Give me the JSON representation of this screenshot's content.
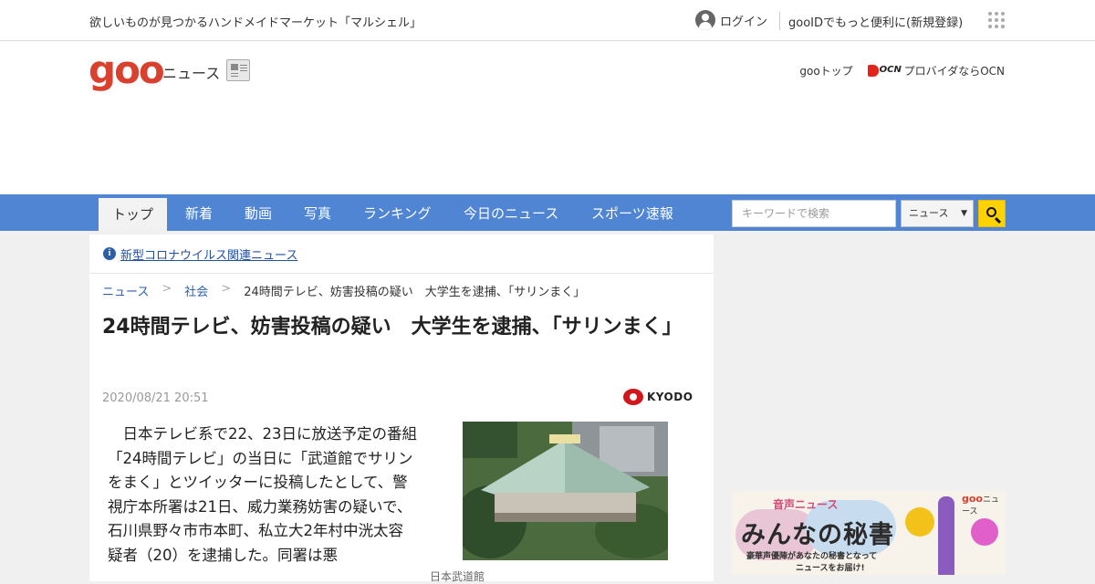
{
  "topbar": {
    "promo": "欲しいものが見つかるハンドメイドマーケット「マルシェル」",
    "login": "ログイン",
    "register": "gooIDでもっと便利に(新規登録)"
  },
  "header": {
    "logo": "goo",
    "logo_sub": "ニュース",
    "goo_top": "gooトップ",
    "ocn_mark": "OCN",
    "ocn_text": "プロバイダならOCN"
  },
  "nav": {
    "tabs": [
      "トップ",
      "新着",
      "動画",
      "写真",
      "ランキング",
      "今日のニュース",
      "スポーツ速報"
    ],
    "search_placeholder": "キーワードで検索",
    "search_scope": "ニュース"
  },
  "notice": {
    "text": "新型コロナウイルス関連ニュース"
  },
  "breadcrumb": {
    "items": [
      "ニュース",
      "社会"
    ],
    "current": "24時間テレビ、妨害投稿の疑い　大学生を逮捕、「サリンまく」"
  },
  "article": {
    "title": "24時間テレビ、妨害投稿の疑い　大学生を逮捕、「サリンまく」",
    "date": "2020/08/21 20:51",
    "source": "KYODO",
    "body": "日本テレビ系で22、23日に放送予定の番組「24時間テレビ」の当日に「武道館でサリンをまく」とツイッターに投稿したとして、警視庁本所署は21日、威力業務妨害の疑いで、石川県野々市市本町、私立大2年村中洸太容疑者（20）を逮捕した。同署は悪",
    "caption": "日本武道館"
  },
  "ad": {
    "tag": "音声ニュース",
    "title": "みんなの秘書",
    "copy1": "豪華声優陣があなたの秘書となって",
    "copy2": "ニュースをお届け!",
    "brand_logo": "goo",
    "brand_sub": "ニュース"
  },
  "colors": {
    "nav_bg": "#4f85d2",
    "logo": "#d9412e",
    "link": "#2a60b0",
    "search_button": "#ffd200"
  }
}
